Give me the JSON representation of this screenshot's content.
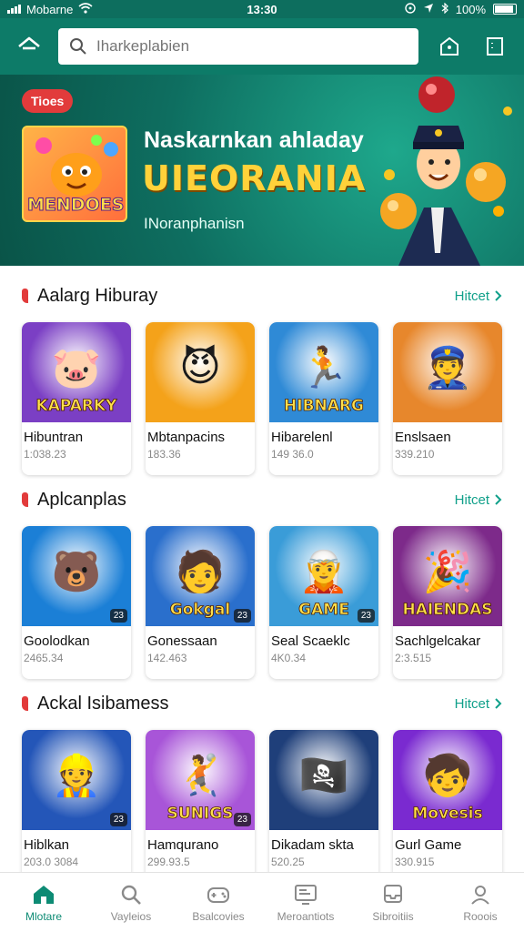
{
  "status": {
    "carrier": "Mobarne",
    "time": "13:30",
    "battery": "100%"
  },
  "search": {
    "placeholder": "Iharkeplabien",
    "value": ""
  },
  "banner": {
    "badge": "Tioes",
    "thumb_label": "MENDOES",
    "title_line1": "Naskarnkan ahladay",
    "title_line2": "UIEORANIA",
    "subtitle": "INoranphanisn"
  },
  "sections": [
    {
      "title": "Aalarg Hiburay",
      "more": "Hitcet",
      "cards": [
        {
          "name": "Hibuntran",
          "meta": "1:038.23",
          "img_text": "KAPARKY",
          "bg": "#7b3fc4",
          "glyph": "🐷",
          "badge": ""
        },
        {
          "name": "Mbtanpacins",
          "meta": "183.36",
          "img_text": "",
          "bg": "#f4a21a",
          "glyph": "😈",
          "badge": ""
        },
        {
          "name": "Hibarelenl",
          "meta": "149 36.0",
          "img_text": "HIBNARG",
          "bg": "#2f8ad6",
          "glyph": "🏃",
          "badge": ""
        },
        {
          "name": "Enslsaen",
          "meta": "339.210",
          "img_text": "",
          "bg": "#e7872c",
          "glyph": "👮",
          "badge": ""
        }
      ]
    },
    {
      "title": "Aplcanplas",
      "more": "Hitcet",
      "cards": [
        {
          "name": "Goolodkan",
          "meta": "2465.34",
          "img_text": "",
          "bg": "#1b7fd6",
          "glyph": "🐻",
          "badge": "23"
        },
        {
          "name": "Gonessaan",
          "meta": "142.463",
          "img_text": "Gokgal",
          "bg": "#2a6fcc",
          "glyph": "🧑",
          "badge": "23"
        },
        {
          "name": "Seal Scaeklc",
          "meta": "4K0.34",
          "img_text": "GAME",
          "bg": "#3a9cd8",
          "glyph": "🧝",
          "badge": "23"
        },
        {
          "name": "Sachlgelcakar",
          "meta": "2:3.515",
          "img_text": "HAIENDAS",
          "bg": "#7d2a8a",
          "glyph": "🎉",
          "badge": ""
        }
      ]
    },
    {
      "title": "Ackal Isibamess",
      "more": "Hitcet",
      "cards": [
        {
          "name": "Hiblkan",
          "meta": "203.0 3084",
          "img_text": "",
          "bg": "#2456b8",
          "glyph": "👷",
          "badge": "23"
        },
        {
          "name": "Hamqurano",
          "meta": "299.93.5",
          "img_text": "SUNIGS",
          "bg": "#a855d8",
          "glyph": "🤾",
          "badge": "23"
        },
        {
          "name": "Dikadam skta",
          "meta": "520.25",
          "img_text": "",
          "bg": "#1f3f7a",
          "glyph": "🏴‍☠️",
          "badge": ""
        },
        {
          "name": "Gurl Game",
          "meta": "330.915",
          "img_text": "Movesis",
          "bg": "#7a2ad0",
          "glyph": "🧒",
          "badge": ""
        }
      ]
    }
  ],
  "nav": [
    {
      "label": "Mlotare",
      "icon": "home-icon",
      "active": true
    },
    {
      "label": "Vayleios",
      "icon": "search-icon",
      "active": false
    },
    {
      "label": "Bsalcovies",
      "icon": "gamepad-icon",
      "active": false
    },
    {
      "label": "Meroantiots",
      "icon": "monitor-icon",
      "active": false
    },
    {
      "label": "Sibroitiis",
      "icon": "inbox-icon",
      "active": false
    },
    {
      "label": "Rooois",
      "icon": "profile-icon",
      "active": false
    }
  ],
  "colors": {
    "header": "#0d7b68",
    "accent": "#10a08a",
    "banner_badge": "#e23b3b",
    "nav_active": "#0d8b74"
  }
}
